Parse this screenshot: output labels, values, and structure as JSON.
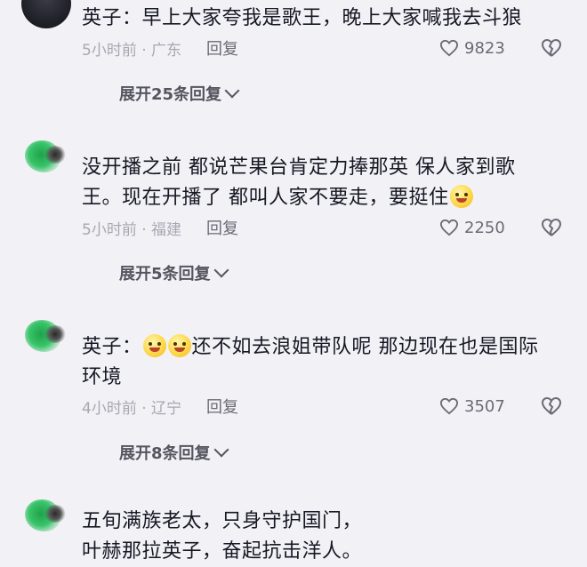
{
  "comments": [
    {
      "nick": "英子：",
      "text": "早上大家夸我是歌王，晚上大家喊我去斗狼",
      "time": "5小时前 · 广东",
      "reply": "回复",
      "likes": "9823",
      "expand": "展开25条回复"
    },
    {
      "text_line1": "没开播之前 都说芒果台肯定力捧那英 保人家到歌",
      "text_line2": "王。现在开播了 都叫人家不要走，要挺住",
      "time": "5小时前 · 福建",
      "reply": "回复",
      "likes": "2250",
      "expand": "展开5条回复"
    },
    {
      "nick": "英子：",
      "text_line1": "还不如去浪姐带队呢 那边现在也是国际",
      "text_line2": "环境",
      "time": "4小时前 · 辽宁",
      "reply": "回复",
      "likes": "3507",
      "expand": "展开8条回复"
    },
    {
      "text_line1": "五旬满族老太，只身守护国门，",
      "text_line2": "叶赫那拉英子，奋起抗击洋人。"
    }
  ],
  "icons": {
    "like": "heart-outline-icon",
    "dislike": "broken-heart-icon",
    "emoji": "smiley-emoji-icon",
    "expand": "chevron-down-icon"
  }
}
